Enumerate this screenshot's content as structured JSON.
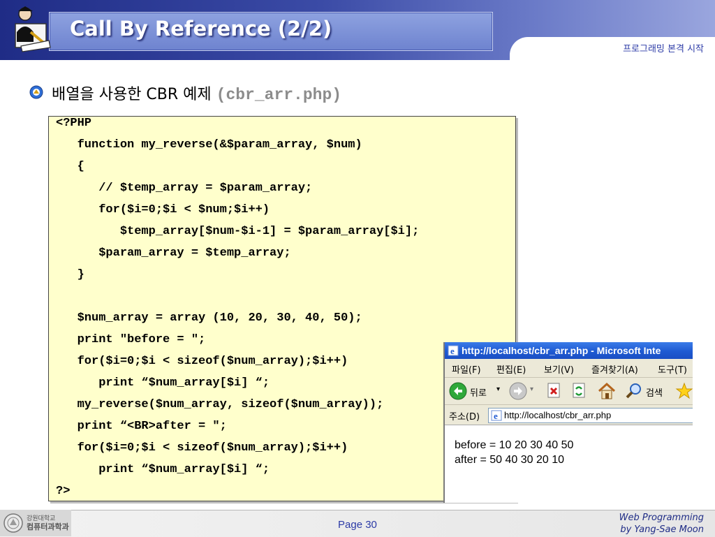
{
  "header": {
    "title": "Call By Reference (2/2)",
    "subtitle": "프로그래밍 본격 시작"
  },
  "bullet": {
    "text": "배열을 사용한 CBR 예제",
    "filename": "(cbr_arr.php)"
  },
  "code": [
    "<?PHP",
    "   function my_reverse(&$param_array, $num)",
    "   {",
    "      // $temp_array = $param_array;",
    "      for($i=0;$i < $num;$i++)",
    "         $temp_array[$num-$i-1] = $param_array[$i];",
    "      $param_array = $temp_array;",
    "   }",
    "",
    "   $num_array = array (10, 20, 30, 40, 50);",
    "   print \"before = \";",
    "   for($i=0;$i < sizeof($num_array);$i++)",
    "      print “$num_array[$i] “;",
    "   my_reverse($num_array, sizeof($num_array));",
    "   print “<BR>after = \";",
    "   for($i=0;$i < sizeof($num_array);$i++)",
    "      print “$num_array[$i] “;",
    "?>"
  ],
  "browser": {
    "title": "http://localhost/cbr_arr.php - Microsoft Inte",
    "menu": [
      "파일(F)",
      "편집(E)",
      "보기(V)",
      "즐겨찾기(A)",
      "도구(T)"
    ],
    "back_label": "뒤로",
    "search_label": "검색",
    "address_label": "주소(D)",
    "address_value": "http://localhost/cbr_arr.php",
    "output_before": "before = 10 20 30 40 50",
    "output_after": "after = 50 40 30 20 10"
  },
  "footer": {
    "logo_line1": "강원대학교",
    "logo_line2": "컴퓨터과학과",
    "page": "Page 30",
    "credit_line1": "Web Programming",
    "credit_line2": "by Yang-Sae Moon"
  },
  "colors": {
    "header_blue": "#1f2c86",
    "code_background": "#ffffcc",
    "xp_title_blue": "#1f5ad2"
  }
}
